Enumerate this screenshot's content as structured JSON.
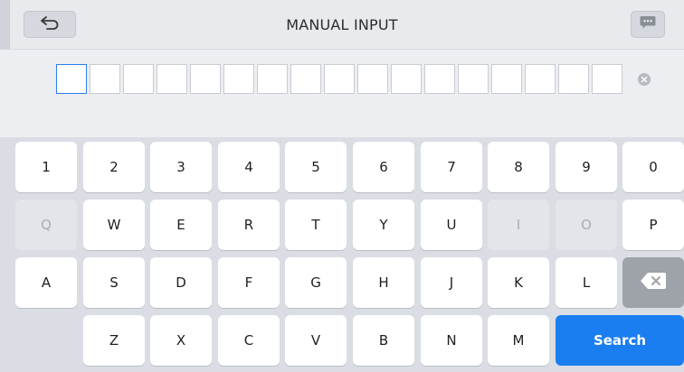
{
  "header": {
    "title": "MANUAL INPUT",
    "back_icon": "back-arrow-icon",
    "message_icon": "chat-bubble-icon"
  },
  "input": {
    "box_count": 17,
    "active_index": 0,
    "clear_icon": "clear-circle-icon"
  },
  "keyboard": {
    "row1": [
      "1",
      "2",
      "3",
      "4",
      "5",
      "6",
      "7",
      "8",
      "9",
      "0"
    ],
    "row2": [
      "Q",
      "W",
      "E",
      "R",
      "T",
      "Y",
      "U",
      "I",
      "O",
      "P"
    ],
    "row2_disabled": [
      "Q",
      "I",
      "O"
    ],
    "row3": [
      "A",
      "S",
      "D",
      "F",
      "G",
      "H",
      "J",
      "K",
      "L"
    ],
    "backspace_icon": "backspace-icon",
    "row4": [
      "Z",
      "X",
      "C",
      "V",
      "B",
      "N",
      "M"
    ],
    "search_label": "Search"
  },
  "colors": {
    "accent": "#1a7ef0",
    "active_box_border": "#2a7df2",
    "backspace_key": "#9ea2a9"
  }
}
